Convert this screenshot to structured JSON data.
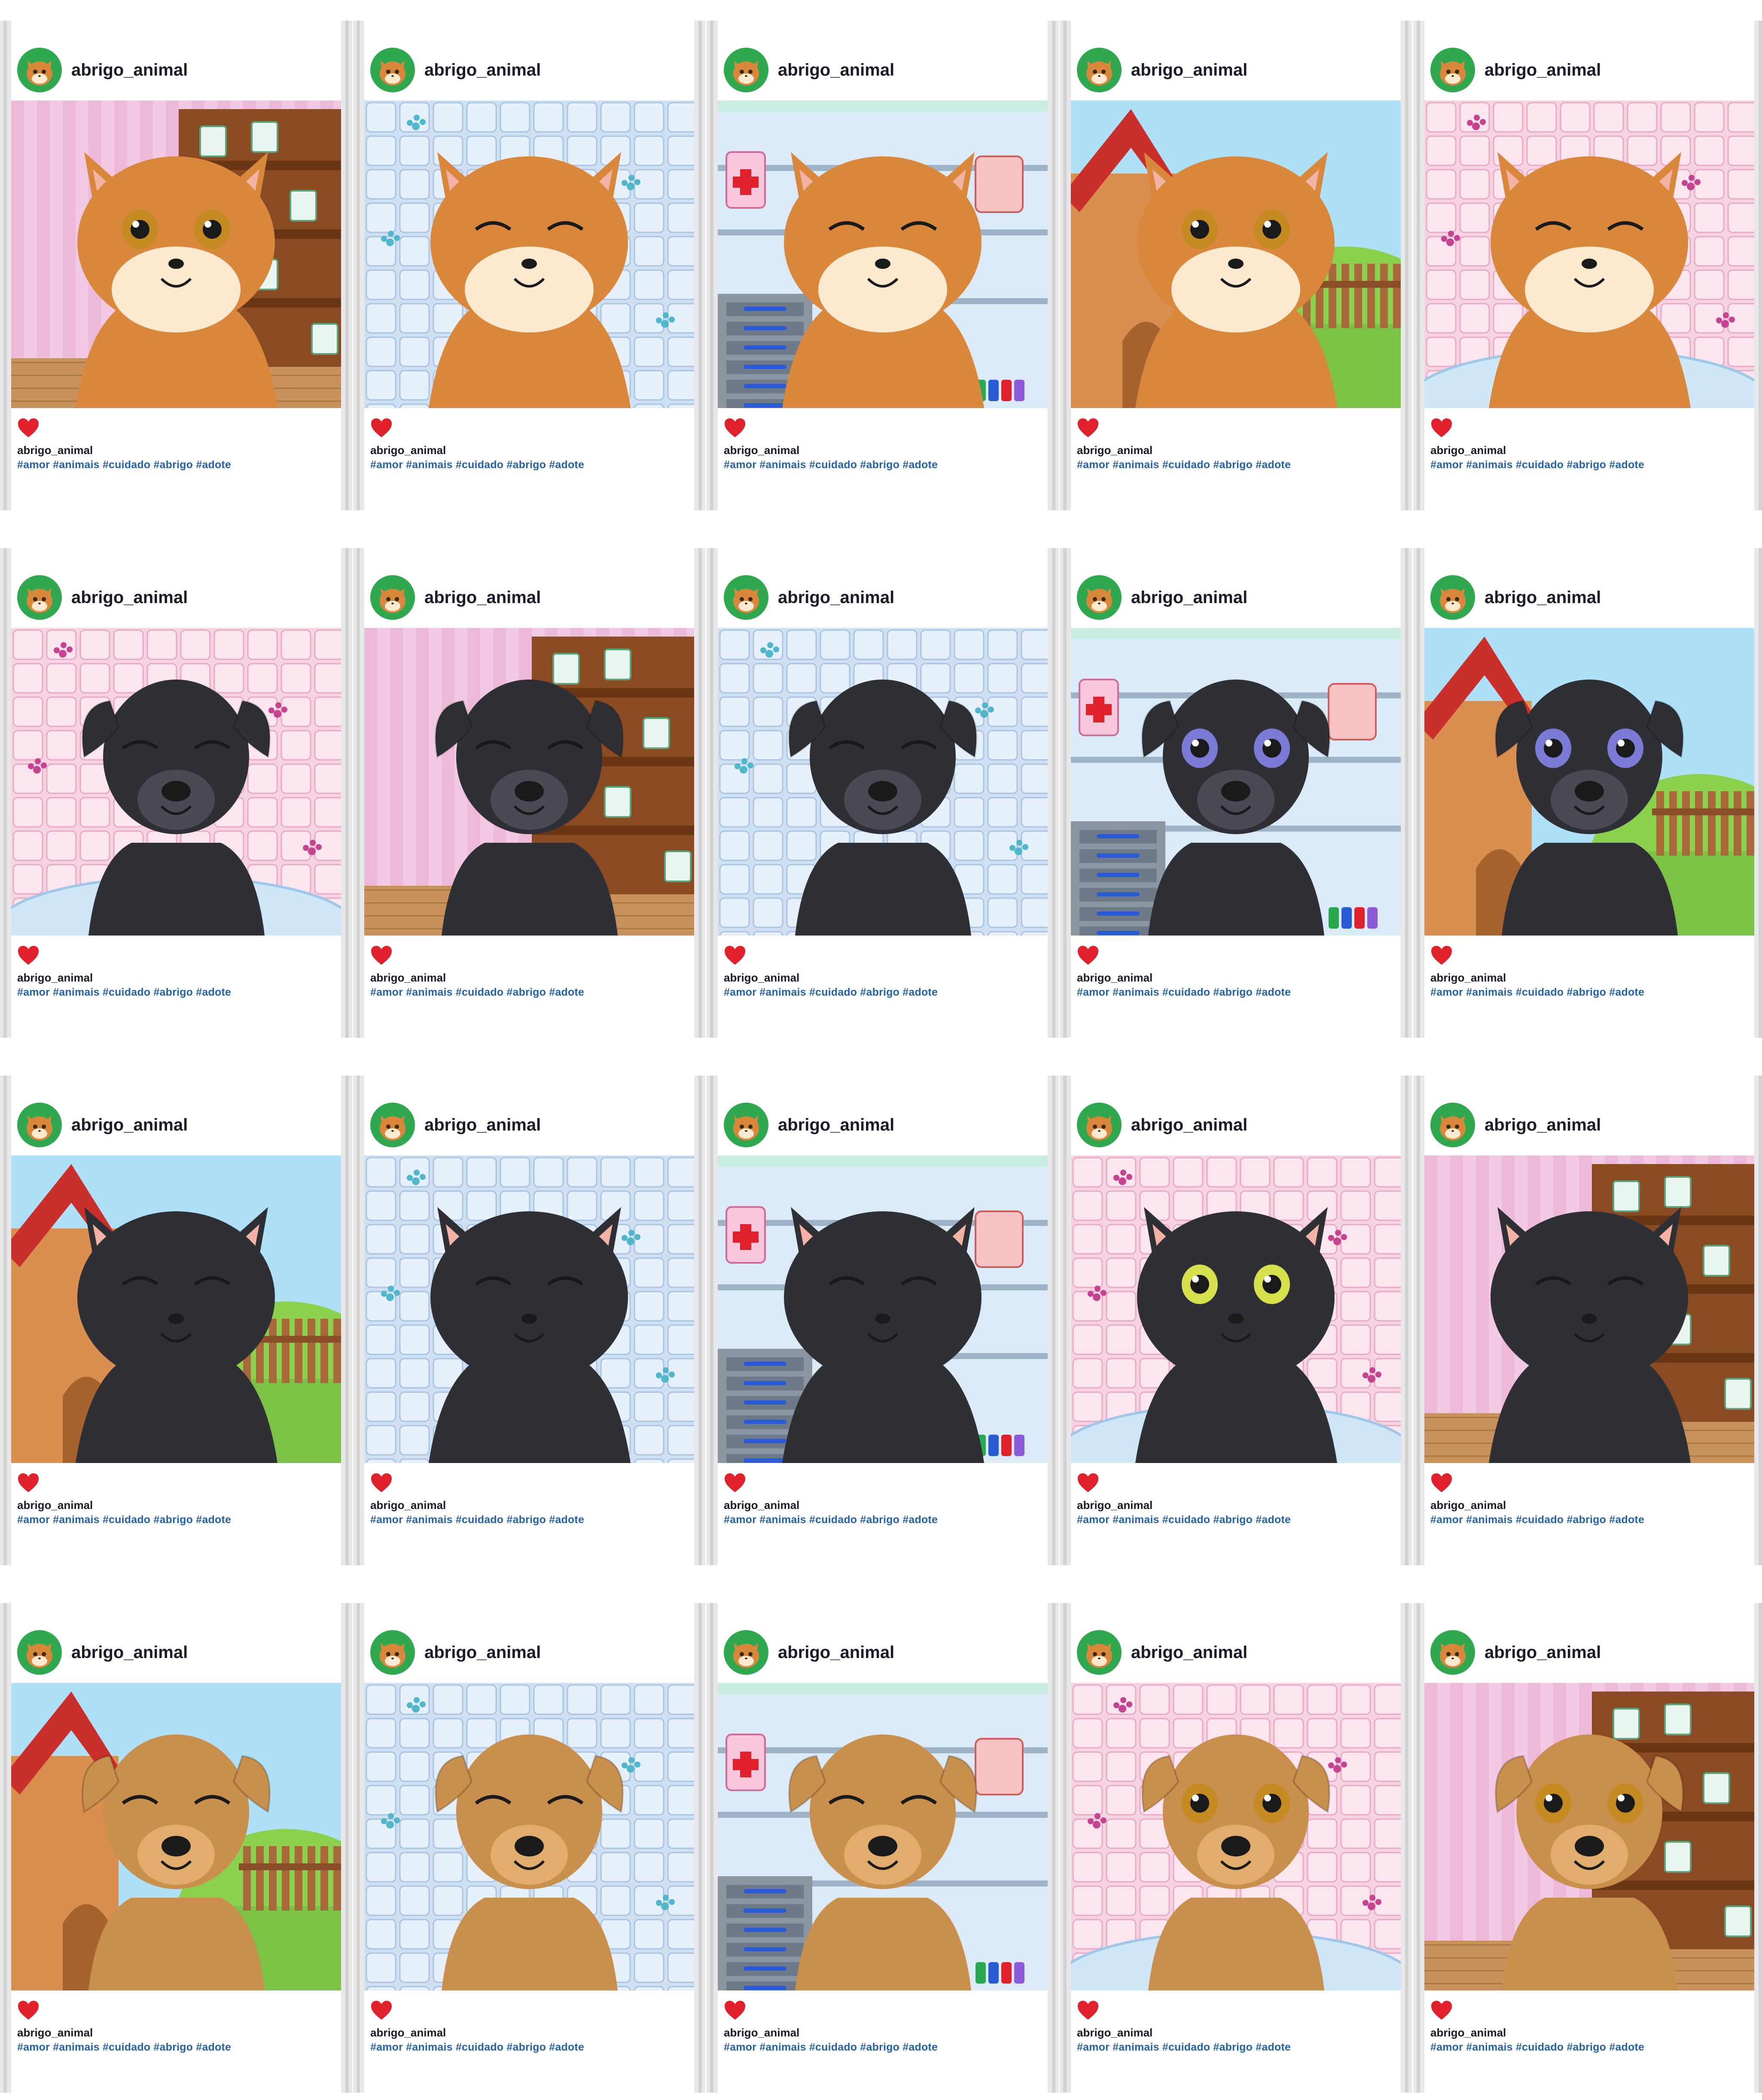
{
  "posts": [
    {
      "username": "abrigo_animal",
      "caption_user": "abrigo_animal",
      "hashtags": "#amor #animais #cuidado #abrigo #adote",
      "pet": "cat",
      "fur": "orange",
      "eyes": "open",
      "background": "shelf-pink"
    },
    {
      "username": "abrigo_animal",
      "caption_user": "abrigo_animal",
      "hashtags": "#amor #animais #cuidado #abrigo #adote",
      "pet": "cat",
      "fur": "orange",
      "eyes": "closed",
      "background": "tiles-blue"
    },
    {
      "username": "abrigo_animal",
      "caption_user": "abrigo_animal",
      "hashtags": "#amor #animais #cuidado #abrigo #adote",
      "pet": "cat",
      "fur": "orange",
      "eyes": "closed",
      "background": "clinic"
    },
    {
      "username": "abrigo_animal",
      "caption_user": "abrigo_animal",
      "hashtags": "#amor #animais #cuidado #abrigo #adote",
      "pet": "cat",
      "fur": "orange",
      "eyes": "open",
      "background": "doghouse"
    },
    {
      "username": "abrigo_animal",
      "caption_user": "abrigo_animal",
      "hashtags": "#amor #animais #cuidado #abrigo #adote",
      "pet": "cat",
      "fur": "orange",
      "eyes": "closed",
      "background": "tiles-pink"
    },
    {
      "username": "abrigo_animal",
      "caption_user": "abrigo_animal",
      "hashtags": "#amor #animais #cuidado #abrigo #adote",
      "pet": "dog",
      "fur": "black",
      "eyes": "closed",
      "background": "tiles-pink"
    },
    {
      "username": "abrigo_animal",
      "caption_user": "abrigo_animal",
      "hashtags": "#amor #animais #cuidado #abrigo #adote",
      "pet": "dog",
      "fur": "black",
      "eyes": "closed",
      "background": "shelf-pink"
    },
    {
      "username": "abrigo_animal",
      "caption_user": "abrigo_animal",
      "hashtags": "#amor #animais #cuidado #abrigo #adote",
      "pet": "dog",
      "fur": "black",
      "eyes": "closed",
      "background": "tiles-blue"
    },
    {
      "username": "abrigo_animal",
      "caption_user": "abrigo_animal",
      "hashtags": "#amor #animais #cuidado #abrigo #adote",
      "pet": "dog",
      "fur": "black",
      "eyes": "open",
      "background": "clinic"
    },
    {
      "username": "abrigo_animal",
      "caption_user": "abrigo_animal",
      "hashtags": "#amor #animais #cuidado #abrigo #adote",
      "pet": "dog",
      "fur": "black",
      "eyes": "open",
      "background": "doghouse"
    },
    {
      "username": "abrigo_animal",
      "caption_user": "abrigo_animal",
      "hashtags": "#amor #animais #cuidado #abrigo #adote",
      "pet": "cat",
      "fur": "black",
      "eyes": "closed",
      "background": "doghouse"
    },
    {
      "username": "abrigo_animal",
      "caption_user": "abrigo_animal",
      "hashtags": "#amor #animais #cuidado #abrigo #adote",
      "pet": "cat",
      "fur": "black",
      "eyes": "closed",
      "background": "tiles-blue"
    },
    {
      "username": "abrigo_animal",
      "caption_user": "abrigo_animal",
      "hashtags": "#amor #animais #cuidado #abrigo #adote",
      "pet": "cat",
      "fur": "black",
      "eyes": "closed",
      "background": "clinic"
    },
    {
      "username": "abrigo_animal",
      "caption_user": "abrigo_animal",
      "hashtags": "#amor #animais #cuidado #abrigo #adote",
      "pet": "cat",
      "fur": "black",
      "eyes": "open",
      "background": "tiles-pink"
    },
    {
      "username": "abrigo_animal",
      "caption_user": "abrigo_animal",
      "hashtags": "#amor #animais #cuidado #abrigo #adote",
      "pet": "cat",
      "fur": "black",
      "eyes": "closed",
      "background": "shelf-pink"
    },
    {
      "username": "abrigo_animal",
      "caption_user": "abrigo_animal",
      "hashtags": "#amor #animais #cuidado #abrigo #adote",
      "pet": "dog",
      "fur": "tan",
      "eyes": "closed",
      "background": "doghouse"
    },
    {
      "username": "abrigo_animal",
      "caption_user": "abrigo_animal",
      "hashtags": "#amor #animais #cuidado #abrigo #adote",
      "pet": "dog",
      "fur": "tan",
      "eyes": "closed",
      "background": "tiles-blue"
    },
    {
      "username": "abrigo_animal",
      "caption_user": "abrigo_animal",
      "hashtags": "#amor #animais #cuidado #abrigo #adote",
      "pet": "dog",
      "fur": "tan",
      "eyes": "closed",
      "background": "clinic"
    },
    {
      "username": "abrigo_animal",
      "caption_user": "abrigo_animal",
      "hashtags": "#amor #animais #cuidado #abrigo #adote",
      "pet": "dog",
      "fur": "tan",
      "eyes": "open",
      "background": "tiles-pink"
    },
    {
      "username": "abrigo_animal",
      "caption_user": "abrigo_animal",
      "hashtags": "#amor #animais #cuidado #abrigo #adote",
      "pet": "dog",
      "fur": "tan",
      "eyes": "open",
      "background": "shelf-pink"
    }
  ],
  "colors": {
    "heart": "#e0202a",
    "hashtag": "#2563a8",
    "avatar_bg": "#2fa84f",
    "fur": {
      "orange": "#d9873a",
      "black": "#2f2f36",
      "tan": "#c98f4c"
    },
    "fur_light": {
      "orange": "#fbe9cf",
      "black": "#4a4a55",
      "tan": "#e0ad6c"
    }
  },
  "icons": {
    "like": "heart-icon",
    "avatar": "cat-avatar-icon"
  }
}
